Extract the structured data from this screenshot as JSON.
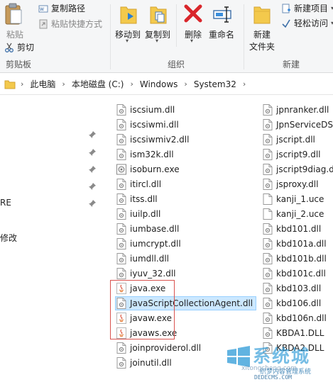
{
  "ribbon": {
    "clipboard": {
      "paste_label": "粘贴",
      "copy_path_label": "复制路径",
      "paste_shortcut_label": "粘贴快捷方式",
      "cut_label": "剪切",
      "group_label": "剪贴板"
    },
    "organize": {
      "move_to_label": "移动到",
      "copy_to_label": "复制到",
      "delete_label": "删除",
      "rename_label": "重命名",
      "group_label": "组织"
    },
    "new": {
      "new_folder_label_1": "新建",
      "new_folder_label_2": "文件夹",
      "new_item_label": "新建项目",
      "easy_access_label": "轻松访问",
      "group_label": "新建"
    }
  },
  "address_bar": {
    "crumbs": [
      "此电脑",
      "本地磁盘 (C:)",
      "Windows",
      "System32"
    ]
  },
  "nav_pane": {
    "partial_text_1": "RE",
    "partial_text_2": "修改"
  },
  "files": {
    "col1": [
      "iscsium.dll",
      "iscsiwmi.dll",
      "iscsiwmiv2.dll",
      "ism32k.dll",
      "isoburn.exe",
      "itircl.dll",
      "itss.dll",
      "iuilp.dll",
      "iumbase.dll",
      "iumcrypt.dll",
      "iumdll.dll",
      "iyuv_32.dll",
      "java.exe",
      "JavaScriptCollectionAgent.dll",
      "javaw.exe",
      "javaws.exe",
      "joinproviderol.dll",
      "joinutil.dll"
    ],
    "col2": [
      "jpnranker.dll",
      "JpnServiceDS.",
      "jscript.dll",
      "jscript9.dll",
      "jscript9diag.d",
      "jsproxy.dll",
      "kanji_1.uce",
      "kanji_2.uce",
      "kbd101.dll",
      "kbd101a.dll",
      "kbd101b.dll",
      "kbd101c.dll",
      "kbd103.dll",
      "kbd106.dll",
      "kbd106n.dll",
      "KBDA1.DLL",
      "KBDA2.DLL"
    ],
    "selected_name": "JavaScriptCollectionAgent.dll"
  },
  "watermark": {
    "brand": "系统城",
    "tagline": "织梦内容管理系统",
    "site": "DEDECMS.COM",
    "url": "xitongcheng.com"
  },
  "colors": {
    "selection_bg": "#cce8ff",
    "highlight_border": "#d9534f",
    "folder_yellow": "#f3c94c",
    "delete_red": "#d9262b"
  }
}
